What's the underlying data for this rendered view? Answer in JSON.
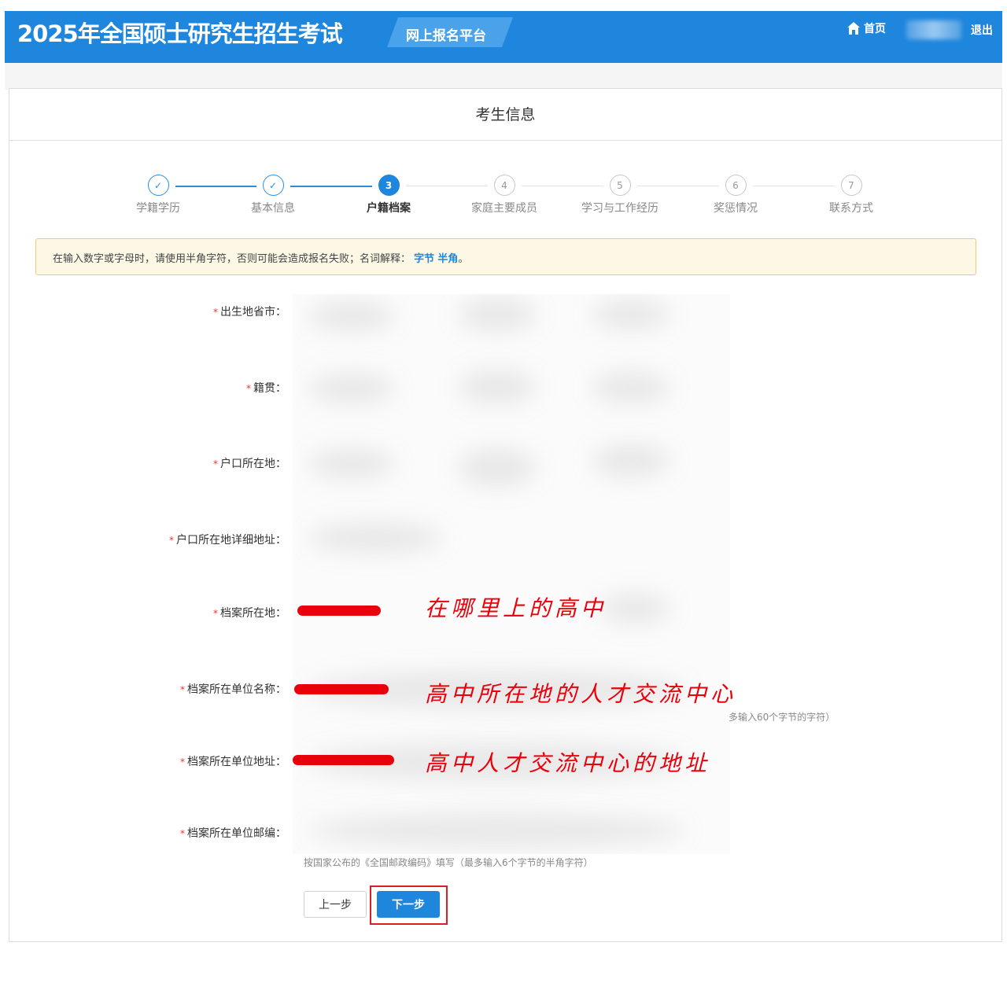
{
  "header": {
    "title": "2025年全国硕士研究生招生考试",
    "platform": "网上报名平台",
    "home_label": "首页",
    "logout_label": "退出"
  },
  "panel": {
    "title": "考生信息"
  },
  "steps": [
    {
      "marker": "✓",
      "label": "学籍学历",
      "state": "done"
    },
    {
      "marker": "✓",
      "label": "基本信息",
      "state": "done"
    },
    {
      "marker": "3",
      "label": "户籍档案",
      "state": "active"
    },
    {
      "marker": "4",
      "label": "家庭主要成员",
      "state": "pending"
    },
    {
      "marker": "5",
      "label": "学习与工作经历",
      "state": "pending"
    },
    {
      "marker": "6",
      "label": "奖惩情况",
      "state": "pending"
    },
    {
      "marker": "7",
      "label": "联系方式",
      "state": "pending"
    }
  ],
  "notice": {
    "text": "在输入数字或字母时，请使用半角字符，否则可能会造成报名失败；名词解释：",
    "link1": "字节",
    "link2": "半角",
    "end": "。"
  },
  "form": {
    "required_mark": "*",
    "birthplace": "出生地省市：",
    "native_place": "籍贯：",
    "hukou": "户口所在地：",
    "hukou_detail": "户口所在地详细地址：",
    "archive_location": "档案所在地：",
    "archive_unit_name": "档案所在单位名称：",
    "archive_unit_address": "档案所在单位地址：",
    "archive_unit_postcode": "档案所在单位邮编：",
    "unit_name_hint": "多输入60个字节的字符）",
    "postcode_hint": "按国家公布的《全国邮政编码》填写（最多输入6个字节的半角字符）"
  },
  "annotations": {
    "a1": "在哪里上的高中",
    "a2": "高中所在地的人才交流中心",
    "a3": "高中人才交流中心的地址"
  },
  "buttons": {
    "prev": "上一步",
    "next": "下一步"
  },
  "colors": {
    "header_blue": "#1e86dd",
    "annotation_red": "#e8000a",
    "notice_border": "#f2c872"
  }
}
